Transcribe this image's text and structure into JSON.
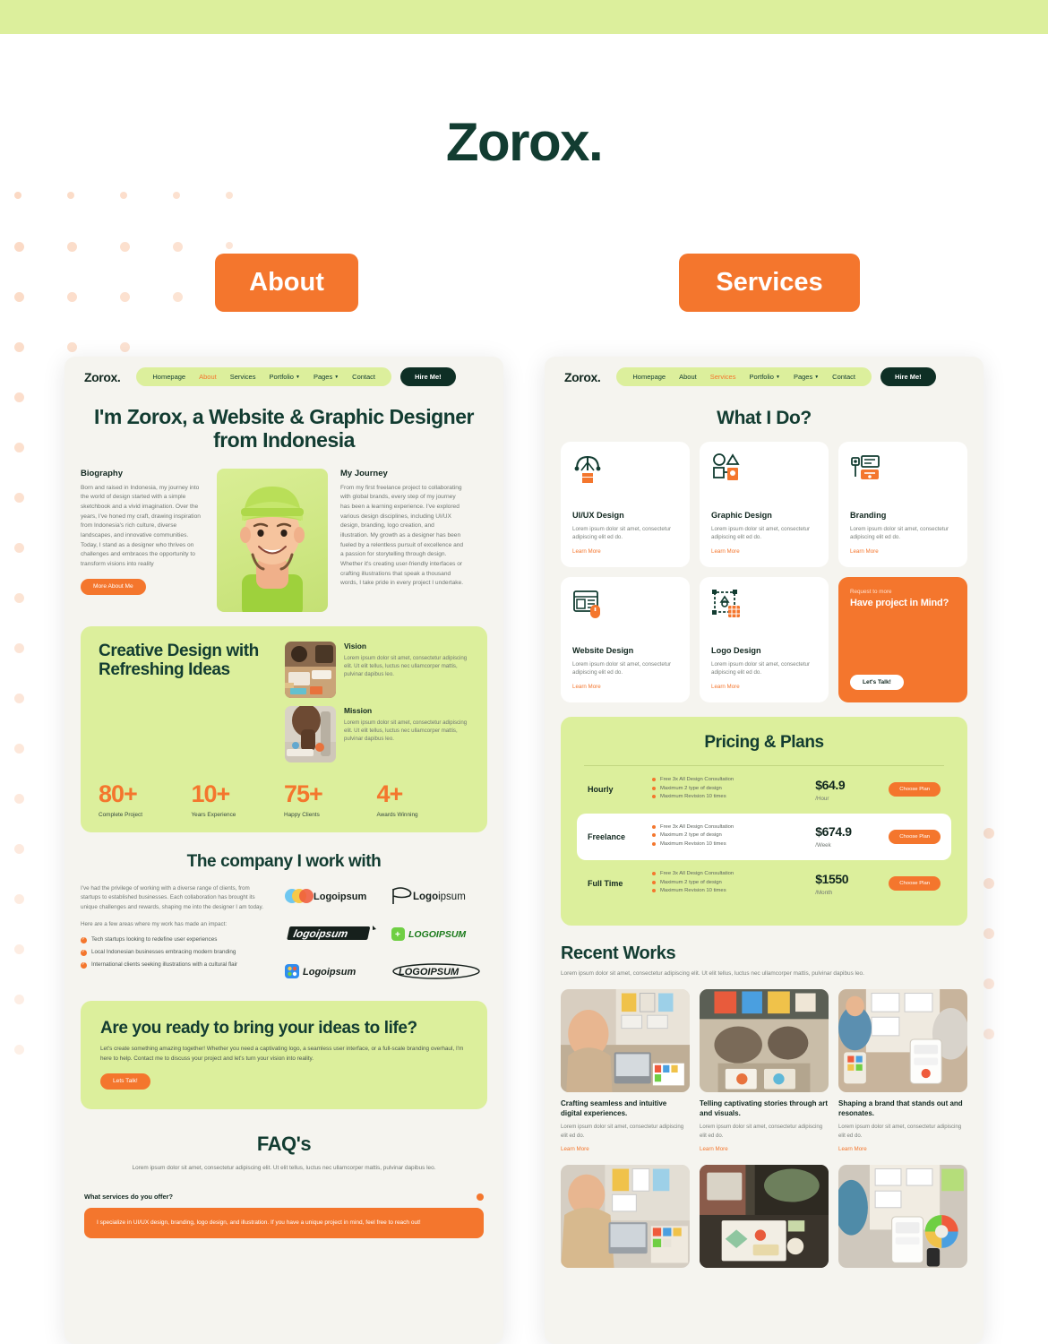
{
  "brand": "Zorox.",
  "top_buttons": {
    "about": "About",
    "services": "Services"
  },
  "nav": {
    "logo": "Zorox.",
    "links": [
      {
        "label": "Homepage",
        "caret": false
      },
      {
        "label": "About",
        "caret": false
      },
      {
        "label": "Services",
        "caret": false
      },
      {
        "label": "Portfolio",
        "caret": true
      },
      {
        "label": "Pages",
        "caret": true
      },
      {
        "label": "Contact",
        "caret": false
      }
    ],
    "cta": "Hire Me!"
  },
  "about_page": {
    "hero_title": "I'm Zorox, a Website & Graphic Designer from Indonesia",
    "biography": {
      "heading": "Biography",
      "text": "Born and raised in Indonesia, my journey into the world of design started with a simple sketchbook and a vivid imagination. Over the years, I've honed my craft, drawing inspiration from Indonesia's rich culture, diverse landscapes, and innovative communities. Today, I stand as a designer who thrives on challenges and embraces the opportunity to transform visions into reality",
      "button": "More About Me"
    },
    "journey": {
      "heading": "My Journey",
      "text": "From my first freelance project to collaborating with global brands, every step of my journey has been a learning experience. I've explored various design disciplines, including UI/UX design, branding, logo creation, and illustration. My growth as a designer has been fueled by a relentless pursuit of excellence and a passion for storytelling through design. Whether it's creating user-friendly interfaces or crafting illustrations that speak a thousand words, I take pride in every project I undertake."
    },
    "creative": {
      "title": "Creative Design with Refreshing Ideas",
      "items": [
        {
          "heading": "Vision",
          "text": "Lorem ipsum dolor sit amet, consectetur adipiscing elit. Ut elit tellus, luctus nec ullamcorper mattis, pulvinar dapibus leo."
        },
        {
          "heading": "Mission",
          "text": "Lorem ipsum dolor sit amet, consectetur adipiscing elit. Ut elit tellus, luctus nec ullamcorper mattis, pulvinar dapibus leo."
        }
      ],
      "stats": [
        {
          "number": "80+",
          "label": "Complete Project"
        },
        {
          "number": "10+",
          "label": "Years Experience"
        },
        {
          "number": "75+",
          "label": "Happy Clients"
        },
        {
          "number": "4+",
          "label": "Awards Winning"
        }
      ]
    },
    "company": {
      "title": "The company I work with",
      "p1": "I've had the privilege of working with a diverse range of clients, from startups to established businesses. Each collaboration has brought its unique challenges and rewards, shaping me into the designer I am today.",
      "p2": "Here are a few areas where my work has made an impact:",
      "bullets": [
        "Tech startups looking to redefine user experiences",
        "Local Indonesian businesses embracing modern branding",
        "International clients seeking illustrations with a cultural flair"
      ],
      "logos": [
        "Logoipsum",
        "Logoipsum",
        "logoipsum",
        "LOGOIPSUM",
        "Logoipsum",
        "LOGOIPSUM"
      ]
    },
    "cta": {
      "title": "Are you ready to bring your ideas to life?",
      "text": "Let's create something amazing together! Whether you need a captivating logo, a seamless user interface, or a full-scale branding overhaul, I'm here to help. Contact me to discuss your project and let's turn your vision into reality.",
      "button": "Lets Talk!"
    },
    "faq": {
      "title": "FAQ's",
      "subtitle": "Lorem ipsum dolor sit amet, consectetur adipiscing elit. Ut elit tellus, luctus nec ullamcorper mattis, pulvinar dapibus leo.",
      "question": "What services do you offer?",
      "answer": "I specialize in UI/UX design, branding, logo design, and illustration. If you have a unique project in mind, feel free to reach out!"
    }
  },
  "services_page": {
    "what_i_do_title": "What I Do?",
    "services": [
      {
        "title": "UI/UX Design",
        "text": "Lorem ipsum dolor sit amet, consectetur adipiscing elit ed do.",
        "link": "Learn More",
        "icon": "pen-tool-icon"
      },
      {
        "title": "Graphic Design",
        "text": "Lorem ipsum dolor sit amet, consectetur adipiscing elit ed do.",
        "link": "Learn More",
        "icon": "shapes-icon"
      },
      {
        "title": "Branding",
        "text": "Lorem ipsum dolor sit amet, consectetur adipiscing elit ed do.",
        "link": "Learn More",
        "icon": "brand-board-icon"
      },
      {
        "title": "Website Design",
        "text": "Lorem ipsum dolor sit amet, consectetur adipiscing elit ed do.",
        "link": "Learn More",
        "icon": "layout-mouse-icon"
      },
      {
        "title": "Logo Design",
        "text": "Lorem ipsum dolor sit amet, consectetur adipiscing elit ed do.",
        "link": "Learn More",
        "icon": "logo-grid-icon"
      }
    ],
    "project_card": {
      "eyebrow": "Request to more",
      "title": "Have project in Mind?",
      "button": "Let's Talk!"
    },
    "pricing": {
      "title": "Pricing & Plans",
      "plans": [
        {
          "name": "Hourly",
          "features": [
            "Free 3x All Design Consultation",
            "Maximum 2 type of design",
            "Maximum Revision 10 times"
          ],
          "price": "$64.9",
          "period": "/Hour",
          "button": "Choose Plan",
          "highlighted": false
        },
        {
          "name": "Freelance",
          "features": [
            "Free 3x All Design Consultation",
            "Maximum 2 type of design",
            "Maximum Revision 10 times"
          ],
          "price": "$674.9",
          "period": "/Week",
          "button": "Choose Plan",
          "highlighted": true
        },
        {
          "name": "Full Time",
          "features": [
            "Free 3x All Design Consultation",
            "Maximum 2 type of design",
            "Maximum Revision 10 times"
          ],
          "price": "$1550",
          "period": "/Month",
          "button": "Choose Plan",
          "highlighted": false
        }
      ]
    },
    "recent_works": {
      "title": "Recent Works",
      "subtitle": "Lorem ipsum dolor sit amet, consectetur adipiscing elit. Ut elit tellus, luctus nec ullamcorper mattis, pulvinar dapibus leo.",
      "items": [
        {
          "title": "Crafting seamless and intuitive digital experiences.",
          "text": "Lorem ipsum dolor sit amet, consectetur adipiscing elit ed do.",
          "link": "Learn More"
        },
        {
          "title": "Telling captivating stories through art and visuals.",
          "text": "Lorem ipsum dolor sit amet, consectetur adipiscing elit ed do.",
          "link": "Learn More"
        },
        {
          "title": "Shaping a brand that stands out and resonates.",
          "text": "Lorem ipsum dolor sit amet, consectetur adipiscing elit ed do.",
          "link": "Learn More"
        }
      ]
    }
  },
  "colors": {
    "accent_orange": "#f4762d",
    "brand_green_dark": "#123c31",
    "lime": "#dcef9c",
    "page_bg": "#ffffff",
    "mock_bg": "#f5f4ef",
    "dot": "#fbd9c4"
  }
}
